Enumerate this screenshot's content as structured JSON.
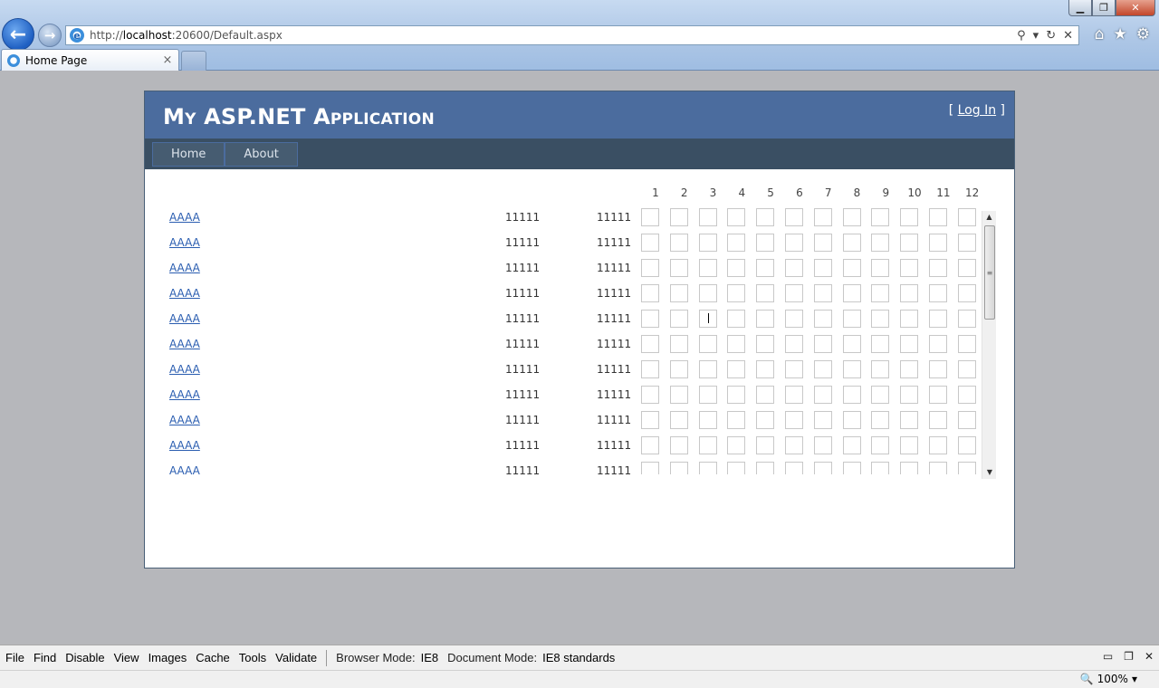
{
  "browser": {
    "url_prefix": "http://",
    "url_host": "localhost",
    "url_rest": ":20600/Default.aspx",
    "tab_title": "Home Page",
    "tab_close": "×",
    "window_controls": [
      "▁",
      "❐",
      "✕"
    ],
    "address_tools": [
      "⚲",
      "▾",
      "↻",
      "✕"
    ],
    "toolbar_icons": [
      "⌂",
      "★",
      "⚙"
    ]
  },
  "site": {
    "title": "My ASP.NET Application",
    "login_prefix": "[ ",
    "login_label": "Log In",
    "login_suffix": " ]",
    "menu": [
      "Home",
      "About"
    ]
  },
  "grid": {
    "column_headers": [
      "1",
      "2",
      "3",
      "4",
      "5",
      "6",
      "7",
      "8",
      "9",
      "10",
      "11",
      "12"
    ],
    "rows": [
      {
        "link": "AAAA",
        "v1": "11111",
        "v2": "11111"
      },
      {
        "link": "AAAA",
        "v1": "11111",
        "v2": "11111"
      },
      {
        "link": "AAAA",
        "v1": "11111",
        "v2": "11111"
      },
      {
        "link": "AAAA",
        "v1": "11111",
        "v2": "11111"
      },
      {
        "link": "AAAA",
        "v1": "11111",
        "v2": "11111"
      },
      {
        "link": "AAAA",
        "v1": "11111",
        "v2": "11111"
      },
      {
        "link": "AAAA",
        "v1": "11111",
        "v2": "11111"
      },
      {
        "link": "AAAA",
        "v1": "11111",
        "v2": "11111"
      },
      {
        "link": "AAAA",
        "v1": "11111",
        "v2": "11111"
      },
      {
        "link": "AAAA",
        "v1": "11111",
        "v2": "11111"
      },
      {
        "link": "AAAA",
        "v1": "11111",
        "v2": "11111"
      }
    ],
    "focused_row": 4,
    "focused_col": 2
  },
  "devtools": {
    "menu": [
      "File",
      "Find",
      "Disable",
      "View",
      "Images",
      "Cache",
      "Tools",
      "Validate"
    ],
    "browser_mode_label": "Browser Mode:",
    "browser_mode_value": "IE8",
    "document_mode_label": "Document Mode:",
    "document_mode_value": "IE8 standards"
  },
  "status": {
    "zoom": "100%"
  }
}
